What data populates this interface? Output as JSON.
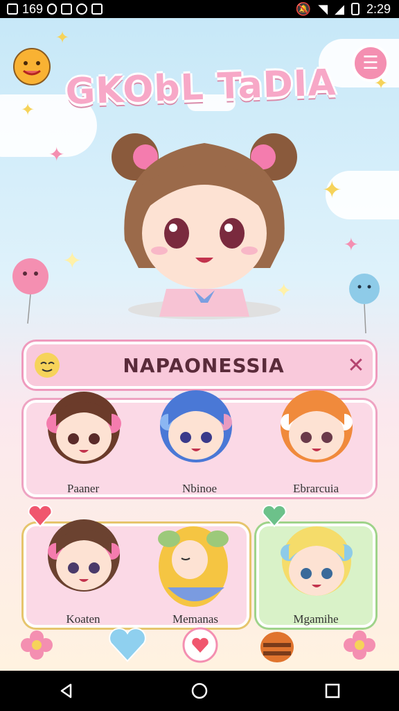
{
  "status": {
    "left_text": "169",
    "time": "2:29"
  },
  "header": {
    "title": "GKObL TaDIA"
  },
  "search": {
    "query": "NAPAONESSIA",
    "close_symbol": "✕"
  },
  "characters": [
    {
      "name": "Paaner"
    },
    {
      "name": "Nbinoe"
    },
    {
      "name": "Ebrarcuia"
    },
    {
      "name": "Koaten"
    },
    {
      "name": "Memanas"
    },
    {
      "name": "Mgamihe"
    }
  ],
  "colors": {
    "accent_pink": "#f48fb1",
    "card_pink": "#fbd9e6",
    "card_green": "#d9f2c8"
  },
  "icons": [
    "mascot-icon",
    "menu-icon",
    "close-icon",
    "heart-badge-icon",
    "check-badge-icon",
    "heart-dock-icon",
    "heart-circle-icon",
    "bee-icon",
    "back-icon",
    "home-icon",
    "recent-icon"
  ]
}
